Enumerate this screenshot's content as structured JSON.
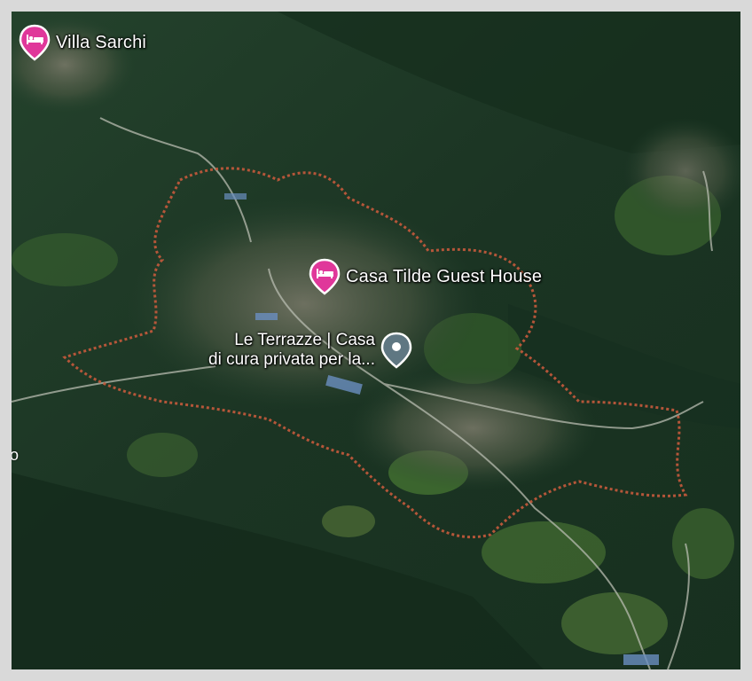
{
  "map": {
    "view": "satellite-3d",
    "colors": {
      "forest": "#1f3a26",
      "hotel_pin": "#e0379a",
      "place_pin": "#5f7782",
      "boundary": "#c65a3c"
    }
  },
  "pois": [
    {
      "label": "Villa Sarchi",
      "icon": "hotel-icon"
    },
    {
      "label": "Casa Tilde Guest House",
      "icon": "hotel-icon"
    },
    {
      "label_line1": "Le Terrazze | Casa",
      "label_line2": "di cura privata per la...",
      "icon": "place-pin-icon"
    }
  ],
  "edge_label": "o"
}
